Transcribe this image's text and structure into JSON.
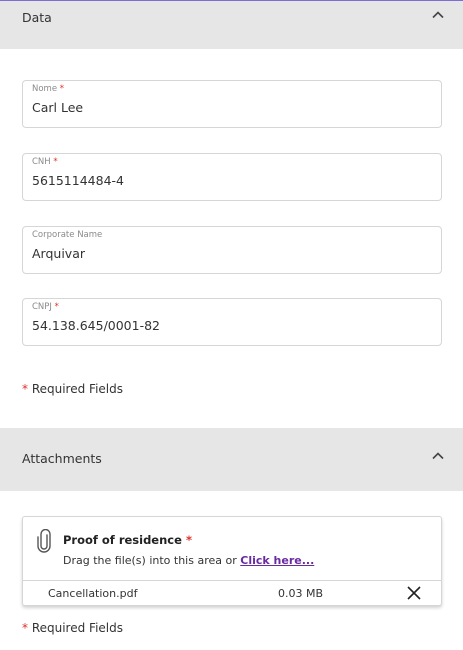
{
  "data_section": {
    "title": "Data",
    "fields": [
      {
        "label": "Nome",
        "required": true,
        "value": "Carl Lee"
      },
      {
        "label": "CNH",
        "required": true,
        "value": "5615114484-4"
      },
      {
        "label": "Corporate Name",
        "required": false,
        "value": "Arquivar"
      },
      {
        "label": "CNPJ",
        "required": true,
        "value": "54.138.645/0001-82"
      }
    ],
    "required_note": {
      "asterisk": "*",
      "text": " Required Fields"
    }
  },
  "attachments_section": {
    "title": "Attachments",
    "upload": {
      "title": "Proof of residence",
      "asterisk": "*",
      "hint": "Drag the file(s) into this area or ",
      "link": "Click here..."
    },
    "files": [
      {
        "name": "Cancellation.pdf",
        "size": "0.03 MB"
      }
    ],
    "required_note": {
      "asterisk": "*",
      "text": " Required Fields"
    }
  },
  "icons": {
    "collapse": "chevron-up-icon",
    "attach": "paperclip-icon",
    "remove": "close-icon"
  },
  "colors": {
    "required": "#e0302a",
    "link": "#6a2aa0",
    "header_bg": "#e6e6e6",
    "accent_border": "#7b6fd6"
  }
}
